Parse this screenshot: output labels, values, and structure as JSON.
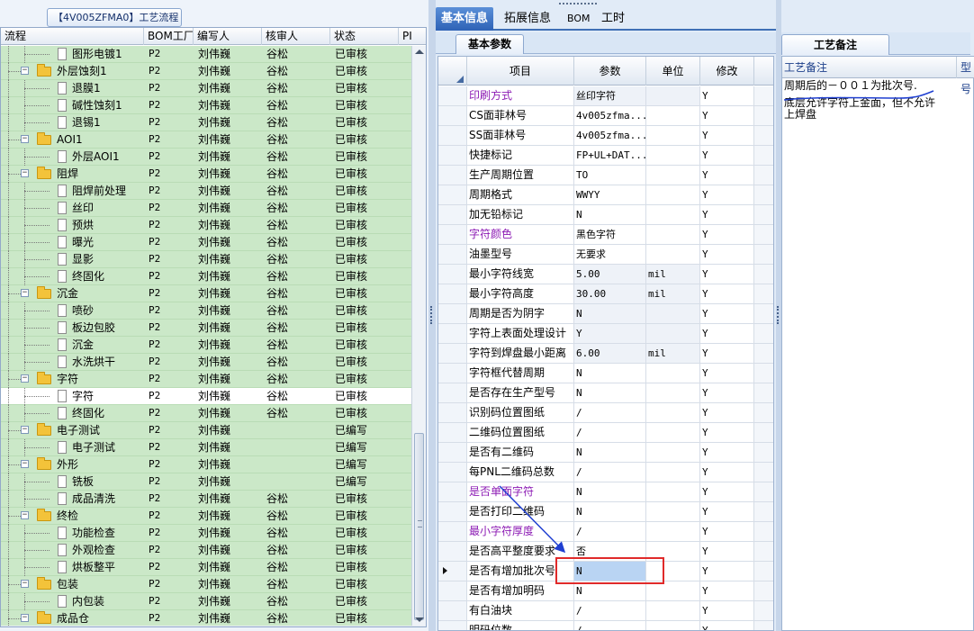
{
  "window": {
    "title": "【4V005ZFMA0】工艺流程"
  },
  "tree": {
    "columns": [
      "流程",
      "BOM工厂",
      "编写人",
      "核审人",
      "状态",
      "PI"
    ],
    "rows": [
      {
        "level": 2,
        "type": "item",
        "name": "图形电镀1",
        "factory": "P2",
        "writer": "刘伟巍",
        "reviewer": "谷松",
        "status": "已审核"
      },
      {
        "level": 1,
        "type": "folder",
        "name": "外层蚀刻1",
        "factory": "P2",
        "writer": "刘伟巍",
        "reviewer": "谷松",
        "status": "已审核"
      },
      {
        "level": 2,
        "type": "item",
        "name": "退膜1",
        "factory": "P2",
        "writer": "刘伟巍",
        "reviewer": "谷松",
        "status": "已审核"
      },
      {
        "level": 2,
        "type": "item",
        "name": "碱性蚀刻1",
        "factory": "P2",
        "writer": "刘伟巍",
        "reviewer": "谷松",
        "status": "已审核"
      },
      {
        "level": 2,
        "type": "item",
        "name": "退锡1",
        "factory": "P2",
        "writer": "刘伟巍",
        "reviewer": "谷松",
        "status": "已审核"
      },
      {
        "level": 1,
        "type": "folder",
        "name": "AOI1",
        "factory": "P2",
        "writer": "刘伟巍",
        "reviewer": "谷松",
        "status": "已审核"
      },
      {
        "level": 2,
        "type": "item",
        "name": "外层AOI1",
        "factory": "P2",
        "writer": "刘伟巍",
        "reviewer": "谷松",
        "status": "已审核"
      },
      {
        "level": 1,
        "type": "folder",
        "name": "阻焊",
        "factory": "P2",
        "writer": "刘伟巍",
        "reviewer": "谷松",
        "status": "已审核"
      },
      {
        "level": 2,
        "type": "item",
        "name": "阻焊前处理",
        "factory": "P2",
        "writer": "刘伟巍",
        "reviewer": "谷松",
        "status": "已审核"
      },
      {
        "level": 2,
        "type": "item",
        "name": "丝印",
        "factory": "P2",
        "writer": "刘伟巍",
        "reviewer": "谷松",
        "status": "已审核"
      },
      {
        "level": 2,
        "type": "item",
        "name": "预烘",
        "factory": "P2",
        "writer": "刘伟巍",
        "reviewer": "谷松",
        "status": "已审核"
      },
      {
        "level": 2,
        "type": "item",
        "name": "曝光",
        "factory": "P2",
        "writer": "刘伟巍",
        "reviewer": "谷松",
        "status": "已审核"
      },
      {
        "level": 2,
        "type": "item",
        "name": "显影",
        "factory": "P2",
        "writer": "刘伟巍",
        "reviewer": "谷松",
        "status": "已审核"
      },
      {
        "level": 2,
        "type": "item",
        "name": "终固化",
        "factory": "P2",
        "writer": "刘伟巍",
        "reviewer": "谷松",
        "status": "已审核"
      },
      {
        "level": 1,
        "type": "folder",
        "name": "沉金",
        "factory": "P2",
        "writer": "刘伟巍",
        "reviewer": "谷松",
        "status": "已审核"
      },
      {
        "level": 2,
        "type": "item",
        "name": "喷砂",
        "factory": "P2",
        "writer": "刘伟巍",
        "reviewer": "谷松",
        "status": "已审核"
      },
      {
        "level": 2,
        "type": "item",
        "name": "板边包胶",
        "factory": "P2",
        "writer": "刘伟巍",
        "reviewer": "谷松",
        "status": "已审核"
      },
      {
        "level": 2,
        "type": "item",
        "name": "沉金",
        "factory": "P2",
        "writer": "刘伟巍",
        "reviewer": "谷松",
        "status": "已审核"
      },
      {
        "level": 2,
        "type": "item",
        "name": "水洗烘干",
        "factory": "P2",
        "writer": "刘伟巍",
        "reviewer": "谷松",
        "status": "已审核"
      },
      {
        "level": 1,
        "type": "folder",
        "name": "字符",
        "factory": "P2",
        "writer": "刘伟巍",
        "reviewer": "谷松",
        "status": "已审核"
      },
      {
        "level": 2,
        "type": "item",
        "name": "字符",
        "factory": "P2",
        "writer": "刘伟巍",
        "reviewer": "谷松",
        "status": "已审核",
        "selected": true
      },
      {
        "level": 2,
        "type": "item",
        "name": "终固化",
        "factory": "P2",
        "writer": "刘伟巍",
        "reviewer": "谷松",
        "status": "已审核"
      },
      {
        "level": 1,
        "type": "folder",
        "name": "电子测试",
        "factory": "P2",
        "writer": "刘伟巍",
        "reviewer": "",
        "status": "已编写"
      },
      {
        "level": 2,
        "type": "item",
        "name": "电子测试",
        "factory": "P2",
        "writer": "刘伟巍",
        "reviewer": "",
        "status": "已编写"
      },
      {
        "level": 1,
        "type": "folder",
        "name": "外形",
        "factory": "P2",
        "writer": "刘伟巍",
        "reviewer": "",
        "status": "已编写"
      },
      {
        "level": 2,
        "type": "item",
        "name": "铣板",
        "factory": "P2",
        "writer": "刘伟巍",
        "reviewer": "",
        "status": "已编写"
      },
      {
        "level": 2,
        "type": "item",
        "name": "成品清洗",
        "factory": "P2",
        "writer": "刘伟巍",
        "reviewer": "谷松",
        "status": "已审核"
      },
      {
        "level": 1,
        "type": "folder",
        "name": "终检",
        "factory": "P2",
        "writer": "刘伟巍",
        "reviewer": "谷松",
        "status": "已审核"
      },
      {
        "level": 2,
        "type": "item",
        "name": "功能检查",
        "factory": "P2",
        "writer": "刘伟巍",
        "reviewer": "谷松",
        "status": "已审核"
      },
      {
        "level": 2,
        "type": "item",
        "name": "外观检查",
        "factory": "P2",
        "writer": "刘伟巍",
        "reviewer": "谷松",
        "status": "已审核"
      },
      {
        "level": 2,
        "type": "item",
        "name": "烘板整平",
        "factory": "P2",
        "writer": "刘伟巍",
        "reviewer": "谷松",
        "status": "已审核"
      },
      {
        "level": 1,
        "type": "folder",
        "name": "包装",
        "factory": "P2",
        "writer": "刘伟巍",
        "reviewer": "谷松",
        "status": "已审核"
      },
      {
        "level": 2,
        "type": "item",
        "name": "内包装",
        "factory": "P2",
        "writer": "刘伟巍",
        "reviewer": "谷松",
        "status": "已审核"
      },
      {
        "level": 1,
        "type": "folder",
        "name": "成品仓",
        "factory": "P2",
        "writer": "刘伟巍",
        "reviewer": "谷松",
        "status": "已审核"
      }
    ]
  },
  "tabs": {
    "top": [
      "基本信息",
      "拓展信息",
      "BOM",
      "工时"
    ],
    "active_top": "基本信息",
    "sub": "基本参数"
  },
  "grid": {
    "columns": [
      "项目",
      "参数",
      "单位",
      "修改"
    ],
    "rows": [
      {
        "item": "印刷方式",
        "value": "丝印字符",
        "unit": "",
        "mod": "Y",
        "purple": true
      },
      {
        "item": "CS面菲林号",
        "value": "4v005zfma...",
        "unit": "",
        "mod": "Y"
      },
      {
        "item": "SS面菲林号",
        "value": "4v005zfma...",
        "unit": "",
        "mod": "Y"
      },
      {
        "item": "快捷标记",
        "value": "FP+UL+DAT...",
        "unit": "",
        "mod": "Y"
      },
      {
        "item": "生产周期位置",
        "value": "TO",
        "unit": "",
        "mod": "Y"
      },
      {
        "item": "周期格式",
        "value": "WWYY",
        "unit": "",
        "mod": "Y"
      },
      {
        "item": "加无铅标记",
        "value": "N",
        "unit": "",
        "mod": "Y"
      },
      {
        "item": "字符颜色",
        "value": "黑色字符",
        "unit": "",
        "mod": "Y",
        "purple": true
      },
      {
        "item": "油墨型号",
        "value": "无要求",
        "unit": "",
        "mod": "Y"
      },
      {
        "item": "最小字符线宽",
        "value": "5.00",
        "unit": "mil",
        "mod": "Y"
      },
      {
        "item": "最小字符高度",
        "value": "30.00",
        "unit": "mil",
        "mod": "Y"
      },
      {
        "item": "周期是否为阴字",
        "value": "N",
        "unit": "",
        "mod": "Y"
      },
      {
        "item": "字符上表面处理设计",
        "value": "Y",
        "unit": "",
        "mod": "Y"
      },
      {
        "item": "字符到焊盘最小距离",
        "value": "6.00",
        "unit": "mil",
        "mod": "Y"
      },
      {
        "item": "字符框代替周期",
        "value": "N",
        "unit": "",
        "mod": "Y"
      },
      {
        "item": "是否存在生产型号",
        "value": "N",
        "unit": "",
        "mod": "Y"
      },
      {
        "item": "识别码位置图纸",
        "value": "/",
        "unit": "",
        "mod": "Y"
      },
      {
        "item": "二维码位置图纸",
        "value": "/",
        "unit": "",
        "mod": "Y"
      },
      {
        "item": "是否有二维码",
        "value": "N",
        "unit": "",
        "mod": "Y"
      },
      {
        "item": "每PNL二维码总数",
        "value": "/",
        "unit": "",
        "mod": "Y"
      },
      {
        "item": "是否单面字符",
        "value": "N",
        "unit": "",
        "mod": "Y",
        "purple": true
      },
      {
        "item": "是否打印二维码",
        "value": "N",
        "unit": "",
        "mod": "Y"
      },
      {
        "item": "最小字符厚度",
        "value": "/",
        "unit": "",
        "mod": "Y",
        "purple": true
      },
      {
        "item": "是否高平整度要求",
        "value": "否",
        "unit": "",
        "mod": "Y"
      },
      {
        "item": "是否有增加批次号",
        "value": "N",
        "unit": "",
        "mod": "Y",
        "current": true
      },
      {
        "item": "是否有增加明码",
        "value": "N",
        "unit": "",
        "mod": "Y"
      },
      {
        "item": "有白油块",
        "value": "/",
        "unit": "",
        "mod": "Y"
      },
      {
        "item": "明码位数",
        "value": "/",
        "unit": "",
        "mod": "Y"
      }
    ]
  },
  "notes": {
    "tab": "工艺备注",
    "header": "工艺备注",
    "header_extra": "型号",
    "lines": [
      "周期后的－００１为批次号.",
      "底层允许字符上金面，但不允许上焊盘"
    ]
  },
  "colors": {
    "tree_row_bg": "#cbe8c8",
    "purple_item": "#8c1bb4",
    "highlight": "#e02a2a",
    "annotation_arrow": "#1f3fd1",
    "active_tab": "#2e62b6"
  }
}
